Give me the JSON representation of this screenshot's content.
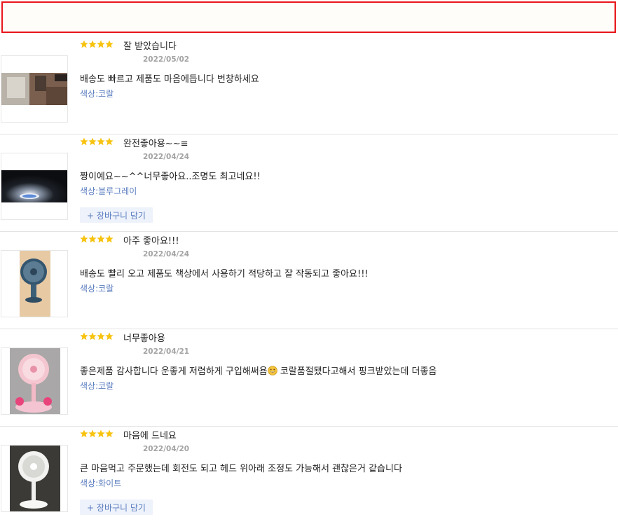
{
  "reviews": [
    {
      "rating": 4,
      "title": "잘 받았습니다",
      "date": "2022/05/02",
      "body": "배송도 빠르고 제품도 마음에듭니다 번창하세요",
      "option": "색상:코랄",
      "cart_label": "",
      "photo": "desk-lamp-fan-photo"
    },
    {
      "rating": 4,
      "title": "완전좋아용~~≡",
      "date": "2022/04/24",
      "body": "짱이예요~~^^너무좋아요..조명도 최고네요!!",
      "option": "색상:블루그레이",
      "cart_label": "+ 장바구니 담기",
      "photo": "fan-light-dark-photo"
    },
    {
      "rating": 4,
      "title": "아주 좋아요!!!",
      "date": "2022/04/24",
      "body": "배송도 빨리 오고 제품도 책상에서 사용하기 적당하고 잘 작동되고 좋아요!!!",
      "option": "색상:코랄",
      "cart_label": "",
      "photo": "blue-fan-photo"
    },
    {
      "rating": 4,
      "title": "너무좋아용",
      "date": "2022/04/21",
      "body_before_emoji": "좋은제품 감사합니다 운좋게 저렴하게 구입해써욤",
      "body_after_emoji": " 코랄품절됐다고해서 핑크받았는데 더좋음",
      "option": "색상:코랄",
      "cart_label": "",
      "photo": "pink-fan-photo"
    },
    {
      "rating": 4,
      "title": "마음에 드네요",
      "date": "2022/04/20",
      "body": "큰 마음먹고 주문했는데 회전도 되고 헤드 위아래 조정도 가능해서 괜찮은거 같습니다",
      "option": "색상:화이트",
      "cart_label": "+ 장바구니 담기",
      "photo": "white-fan-photo"
    }
  ],
  "colors": {
    "star": "#f7c30e",
    "option": "#5a7dbf",
    "banner_border": "#e8161a"
  }
}
